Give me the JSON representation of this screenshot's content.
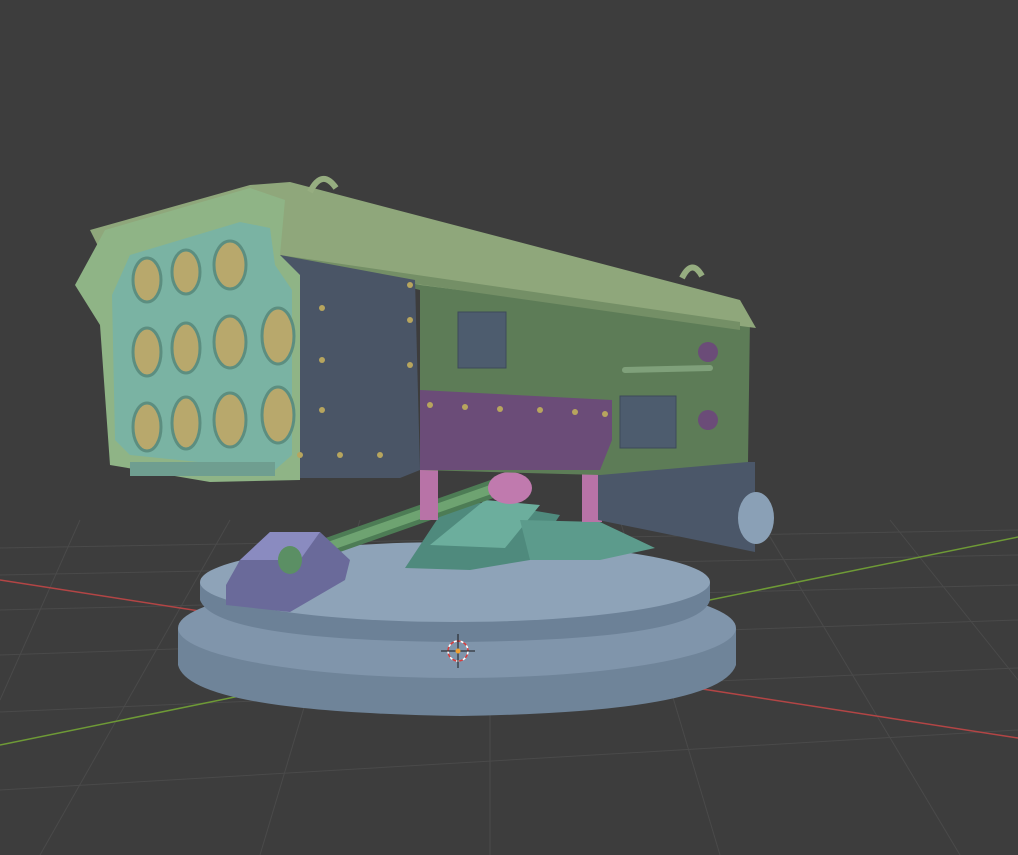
{
  "viewport": {
    "background": "#3d3d3d",
    "grid_color": "#4a4a4a",
    "x_axis_color": "#b34545",
    "y_axis_color": "#6e9a36"
  },
  "model": {
    "base_color": "#7d93a9",
    "cover_color": "#8da37a",
    "body_color": "#5f7d59",
    "face_color": "#7ab3a3",
    "tube_color": "#b8a86c",
    "panel_color": "#4a5566",
    "band_color": "#6b4c78",
    "mount_color": "#6a6a9a",
    "arm_color": "#5e8a66",
    "pivot_color": "#c07aae",
    "end_cap_color": "#8095ac",
    "rivet_color": "#b7a55e"
  },
  "cursor": {
    "icon": "3d-cursor-icon"
  }
}
